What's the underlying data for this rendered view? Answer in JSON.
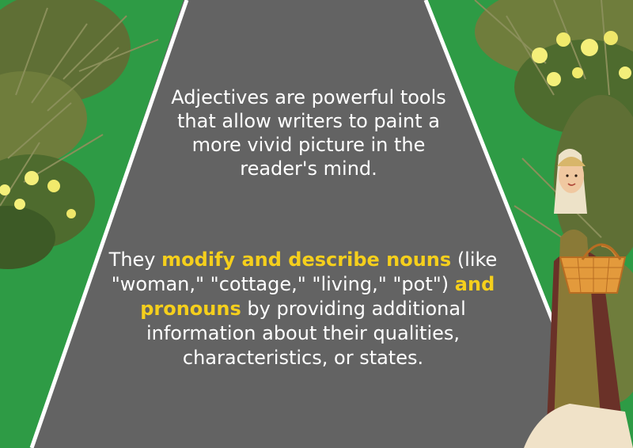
{
  "paragraph1": "Adjectives are powerful tools that allow writers to paint a more vivid picture in the reader's mind.",
  "paragraph2": {
    "part1": "They ",
    "highlight1": "modify and describe nouns",
    "part2": " (like \"woman,\" \"cottage,\" \"living,\" \"pot\") ",
    "highlight2": "and pronouns",
    "part3": " by providing additional information about their qualities, characteristics, or states."
  },
  "colors": {
    "grass": "#2e9b45",
    "road": "#636363",
    "road_edge": "#ffffff",
    "highlight": "#f5cf1c",
    "text": "#ffffff"
  },
  "icons": {
    "left_bushes": "yellow-flower-bush-icon",
    "right_bushes": "yellow-flower-bush-icon",
    "character": "woman-with-basket-icon"
  }
}
